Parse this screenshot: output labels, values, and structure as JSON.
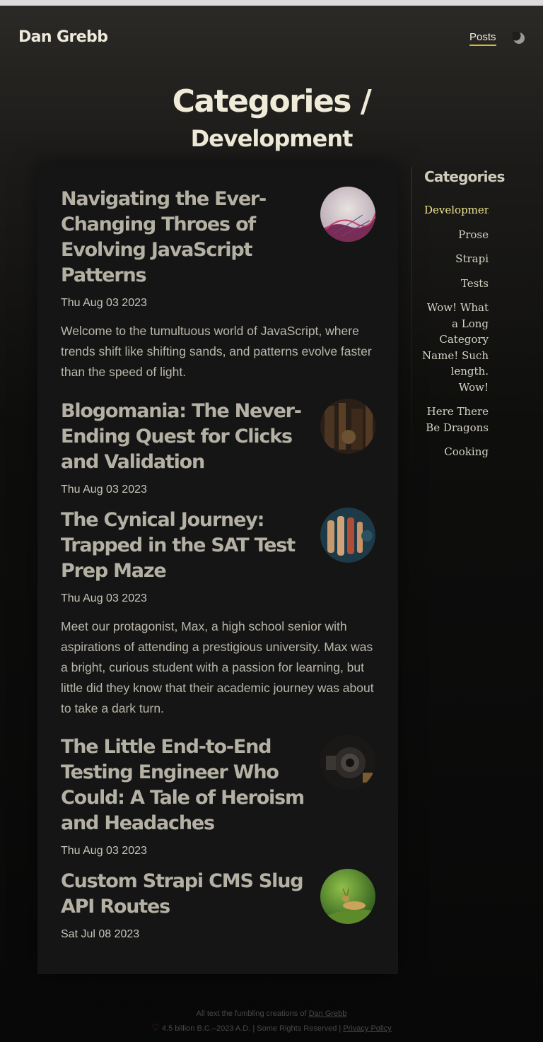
{
  "site": {
    "brand": "Dan Grebb"
  },
  "nav": {
    "posts_label": "Posts",
    "theme_toggle_icon": "moon-icon"
  },
  "page": {
    "title_line1": "Categories /",
    "title_line2": "Development"
  },
  "posts": [
    {
      "title": "Navigating the Ever-Changing Throes of Evolving JavaScript Patterns",
      "date": "Thu Aug 03 2023",
      "excerpt": "Welcome to the tumultuous world of JavaScript, where trends shift like shifting sands, and patterns evolve faster than the speed of light."
    },
    {
      "title": "Blogomania: The Never-Ending Quest for Clicks and Validation",
      "date": "Thu Aug 03 2023",
      "excerpt": ""
    },
    {
      "title": "The Cynical Journey: Trapped in the SAT Test Prep Maze",
      "date": "Thu Aug 03 2023",
      "excerpt": "Meet our protagonist, Max, a high school senior with aspirations of attending a prestigious university. Max was a bright, curious student with a passion for learning, but little did they know that their academic journey was about to take a dark turn."
    },
    {
      "title": "The Little End-to-End Testing Engineer Who Could: A Tale of Heroism and Headaches",
      "date": "Thu Aug 03 2023",
      "excerpt": ""
    },
    {
      "title": "Custom Strapi CMS Slug API Routes",
      "date": "Sat Jul 08 2023",
      "excerpt": ""
    }
  ],
  "sidebar": {
    "heading": "Categories",
    "items": [
      {
        "label": "Development"
      },
      {
        "label": "Prose"
      },
      {
        "label": "Strapi"
      },
      {
        "label": "Tests"
      },
      {
        "label": "Wow! What a Long Category Name! Such length. Wow!"
      },
      {
        "label": "Here There Be Dragons"
      },
      {
        "label": "Cooking"
      }
    ]
  },
  "footer": {
    "line1_text": "All text the fumbling creations of",
    "line1_link": "Dan Grebb",
    "line2_text": "4.5 billion B.C.–2023 A.D. | Some Rights Reserved |",
    "line2_link": "Privacy Policy"
  },
  "colors": {
    "accent": "#d8b83a",
    "active_category": "#ece58c",
    "heart": "#5b2a2a"
  }
}
